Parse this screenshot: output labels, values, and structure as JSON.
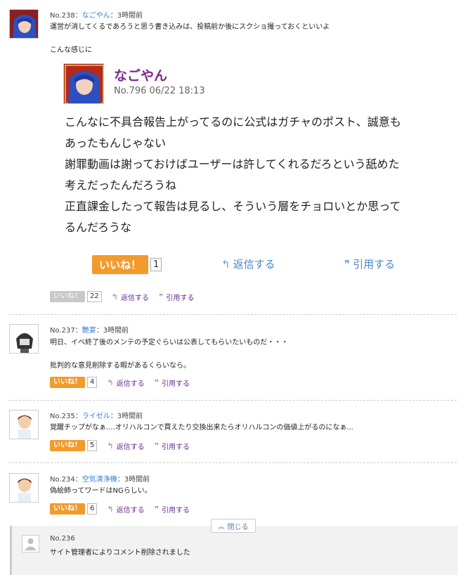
{
  "comments": [
    {
      "no": "No.238",
      "sep1": "：",
      "name": "なごやん",
      "sep2": "：",
      "time": "3時間前",
      "lines": [
        "運営が消してくるであろうと思う書き込みは、投稿前か後にスクショ撮っておくといいよ",
        "",
        "こんな感じに"
      ],
      "like": "いいね！",
      "count": "22",
      "reply": "返信する",
      "quote": "引用する"
    },
    {
      "no": "No.237",
      "sep1": "：",
      "name": "艶宴",
      "sep2": "：",
      "time": "3時間前",
      "lines": [
        "明日、イベ終了後のメンテの予定ぐらいは公表してもらいたいものだ・・・",
        "",
        "批判的な意見削除する暇があるくらいなら。"
      ],
      "like": "いいね！",
      "count": "4",
      "reply": "返信する",
      "quote": "引用する"
    },
    {
      "no": "No.235",
      "sep1": "：",
      "name": "ライゼル",
      "sep2": "：",
      "time": "3時間前",
      "lines": [
        "覚醒チップがなぁ....オリハルコンで買えたり交換出来たらオリハルコンの価値上がるのになぁ..."
      ],
      "like": "いいね！",
      "count": "5",
      "reply": "返信する",
      "quote": "引用する"
    },
    {
      "no": "No.234",
      "sep1": "：",
      "name": "空気清浄機",
      "sep2": "：",
      "time": "3時間前",
      "lines": [
        "偽絵師ってワードはNGらしい。"
      ],
      "like": "いいね！",
      "count": "6",
      "reply": "返信する",
      "quote": "引用する"
    }
  ],
  "embedded": {
    "name": "なごやん",
    "meta": "No.796 06/22 18:13",
    "body": "こんなに不具合報告上がってるのに公式はガチャのポスト、誠意も\nあったもんじゃない\n謝罪動画は謝っておけばユーザーは許してくれるだろという舐めた\n考えだったんだろうね\n正直課金したって報告は見るし、そういう層をチョロいとか思って\nるんだろうな",
    "like": "いいね！",
    "count": "1",
    "reply": "返信する",
    "quote": "引用する"
  },
  "deleted": {
    "close": "閉じる",
    "no": "No.236",
    "text": "サイト管理者によりコメント削除されました"
  },
  "colors": {
    "like": "#f39a2b",
    "link": "#3a7bd5",
    "action": "#6a2f8e"
  }
}
